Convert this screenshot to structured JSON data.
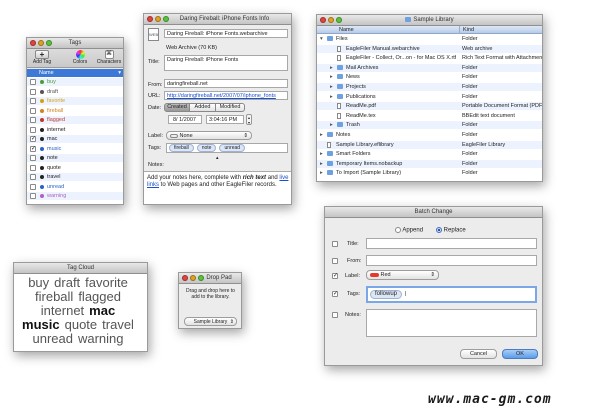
{
  "tags_window": {
    "title": "Tags",
    "toolbar": [
      "Add Tag",
      "Colors",
      "Characters"
    ],
    "header": "Name",
    "items": [
      {
        "mark": "",
        "name": "buy",
        "color": "#4a9e3a"
      },
      {
        "mark": "",
        "name": "draft",
        "color": "#555555"
      },
      {
        "mark": "",
        "name": "favorite",
        "color": "#d4a017"
      },
      {
        "mark": "",
        "name": "fireball",
        "color": "#d4821a"
      },
      {
        "mark": "",
        "name": "flagged",
        "color": "#c0392b"
      },
      {
        "mark": "",
        "name": "internet",
        "color": "#222222"
      },
      {
        "mark": "✓",
        "name": "mac",
        "color": "#222222"
      },
      {
        "mark": "✓",
        "name": "music",
        "color": "#2a62c8"
      },
      {
        "mark": "",
        "name": "note",
        "color": "#222222"
      },
      {
        "mark": "",
        "name": "quote",
        "color": "#222222"
      },
      {
        "mark": "",
        "name": "travel",
        "color": "#222222"
      },
      {
        "mark": "",
        "name": "unread",
        "color": "#2a62c8"
      },
      {
        "mark": "",
        "name": "warning",
        "color": "#b05fc4"
      }
    ]
  },
  "info_window": {
    "title": "Daring Fireball: iPhone Fonts Info",
    "filename": "Daring Fireball: iPhone Fonts.webarchive",
    "filesize": "Web Archive (70 KB)",
    "title_label": "Title:",
    "title_value": "Daring Fireball: iPhone Fonts",
    "from_label": "From:",
    "from_value": "daringfireball.net",
    "url_label": "URL:",
    "url_value": "http://daringfireball.net/2007/07/iphone_fonts",
    "date_label": "Date:",
    "date_tabs": [
      "Created",
      "Added",
      "Modified"
    ],
    "date_value": "8/ 1/2007",
    "time_value": "3:04:16 PM",
    "label_label": "Label:",
    "label_value": "None",
    "tags_label": "Tags:",
    "tags": [
      "fireball",
      "note",
      "unread"
    ],
    "notes_label": "Notes:",
    "notes_part1": "Add your notes here, complete with ",
    "notes_rich": "rich text",
    "notes_part2": " and ",
    "notes_link": "live links",
    "notes_part3": " to Web pages and other EagleFiler records."
  },
  "library_window": {
    "title": "Sample Library",
    "col_name": "Name",
    "col_kind": "Kind",
    "rows": [
      {
        "name": "Files",
        "kind": "Folder",
        "type": "folder"
      },
      {
        "name": "EagleFiler Manual.webarchive",
        "kind": "Web archive",
        "type": "doc"
      },
      {
        "name": "EagleFiler - Collect, Or...on - for Mac OS X.rtfd",
        "kind": "Rich Text Format with Attachments",
        "type": "doc"
      },
      {
        "name": "Mail Archives",
        "kind": "Folder",
        "type": "folder"
      },
      {
        "name": "News",
        "kind": "Folder",
        "type": "folder"
      },
      {
        "name": "Projects",
        "kind": "Folder",
        "type": "folder"
      },
      {
        "name": "Publications",
        "kind": "Folder",
        "type": "folder"
      },
      {
        "name": "ReadMe.pdf",
        "kind": "Portable Document Format (PDF)",
        "type": "doc"
      },
      {
        "name": "ReadMe.tex",
        "kind": "BBEdit text document",
        "type": "doc"
      },
      {
        "name": "Trash",
        "kind": "Folder",
        "type": "folder"
      },
      {
        "name": "Notes",
        "kind": "Folder",
        "type": "folder"
      },
      {
        "name": "Sample Library.eflibrary",
        "kind": "EagleFiler Library",
        "type": "doc"
      },
      {
        "name": "Smart Folders",
        "kind": "Folder",
        "type": "folder"
      },
      {
        "name": "Temporary Items.nobackup",
        "kind": "Folder",
        "type": "folder"
      },
      {
        "name": "To Import (Sample Library)",
        "kind": "Folder",
        "type": "folder"
      }
    ]
  },
  "batch_window": {
    "title": "Batch Change",
    "append": "Append",
    "replace": "Replace",
    "title_label": "Title:",
    "from_label": "From:",
    "label_label": "Label:",
    "label_value": "Red",
    "tags_label": "Tags:",
    "tag_token": "followup",
    "notes_label": "Notes:",
    "cancel": "Cancel",
    "ok": "OK"
  },
  "cloud_window": {
    "title": "Tag Cloud",
    "words": [
      {
        "text": "buy",
        "weight": "normal",
        "size": 13
      },
      {
        "text": "draft",
        "weight": "normal",
        "size": 13
      },
      {
        "text": "favorite",
        "weight": "normal",
        "size": 13
      },
      {
        "text": "fireball",
        "weight": "normal",
        "size": 13
      },
      {
        "text": "flagged",
        "weight": "normal",
        "size": 13
      },
      {
        "text": "internet",
        "weight": "normal",
        "size": 13
      },
      {
        "text": "mac",
        "weight": "bold",
        "size": 13
      },
      {
        "text": "music",
        "weight": "bold",
        "size": 13
      },
      {
        "text": "quote",
        "weight": "normal",
        "size": 13
      },
      {
        "text": "travel",
        "weight": "normal",
        "size": 13
      },
      {
        "text": "unread",
        "weight": "normal",
        "size": 13
      },
      {
        "text": "warning",
        "weight": "normal",
        "size": 13
      }
    ]
  },
  "droppad_window": {
    "title": "Drop Pad",
    "text": "Drag and drop here to add to the library.",
    "library": "Sample Library"
  },
  "watermark": "www.mac-gm.com"
}
